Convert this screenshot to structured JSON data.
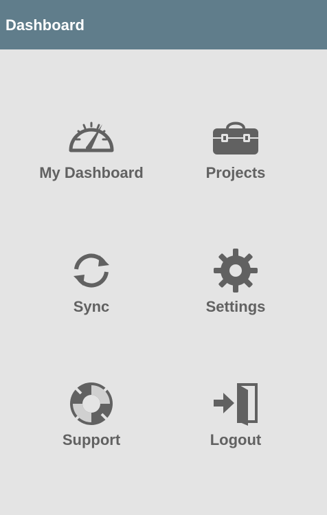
{
  "app_bar": {
    "title": "Dashboard",
    "background": "#607d8b"
  },
  "menu": {
    "items": [
      {
        "label": "My Dashboard",
        "icon": "speedometer-icon"
      },
      {
        "label": "Projects",
        "icon": "toolbox-icon"
      },
      {
        "label": "Sync",
        "icon": "sync-icon"
      },
      {
        "label": "Settings",
        "icon": "gear-icon"
      },
      {
        "label": "Support",
        "icon": "lifebuoy-icon"
      },
      {
        "label": "Logout",
        "icon": "logout-icon"
      }
    ]
  },
  "colors": {
    "background": "#e4e4e4",
    "icon_and_text": "#616161"
  }
}
